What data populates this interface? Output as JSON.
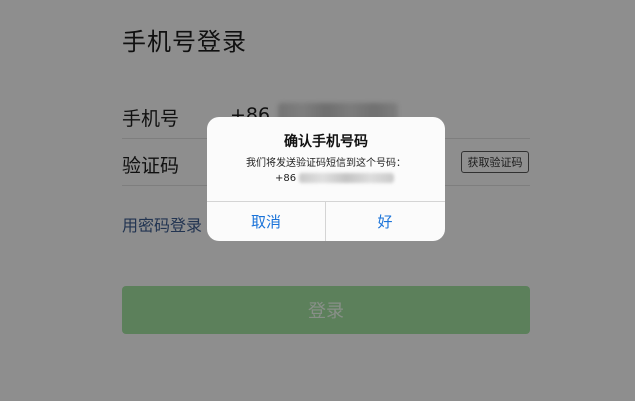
{
  "page": {
    "title": "手机号登录"
  },
  "form": {
    "phone_label": "手机号",
    "country_code": "+86",
    "code_label": "验证码",
    "get_code_label": "获取验证码",
    "password_login_label": "用密码登录",
    "login_label": "登录"
  },
  "dialog": {
    "title": "确认手机号码",
    "message": "我们将发送验证码短信到这个号码：",
    "number_prefix": "+86",
    "cancel_label": "取消",
    "ok_label": "好"
  },
  "colors": {
    "login_button": "#9fdc9d",
    "link": "#3b5b8c",
    "dialog_button_text": "#1a73d9"
  }
}
